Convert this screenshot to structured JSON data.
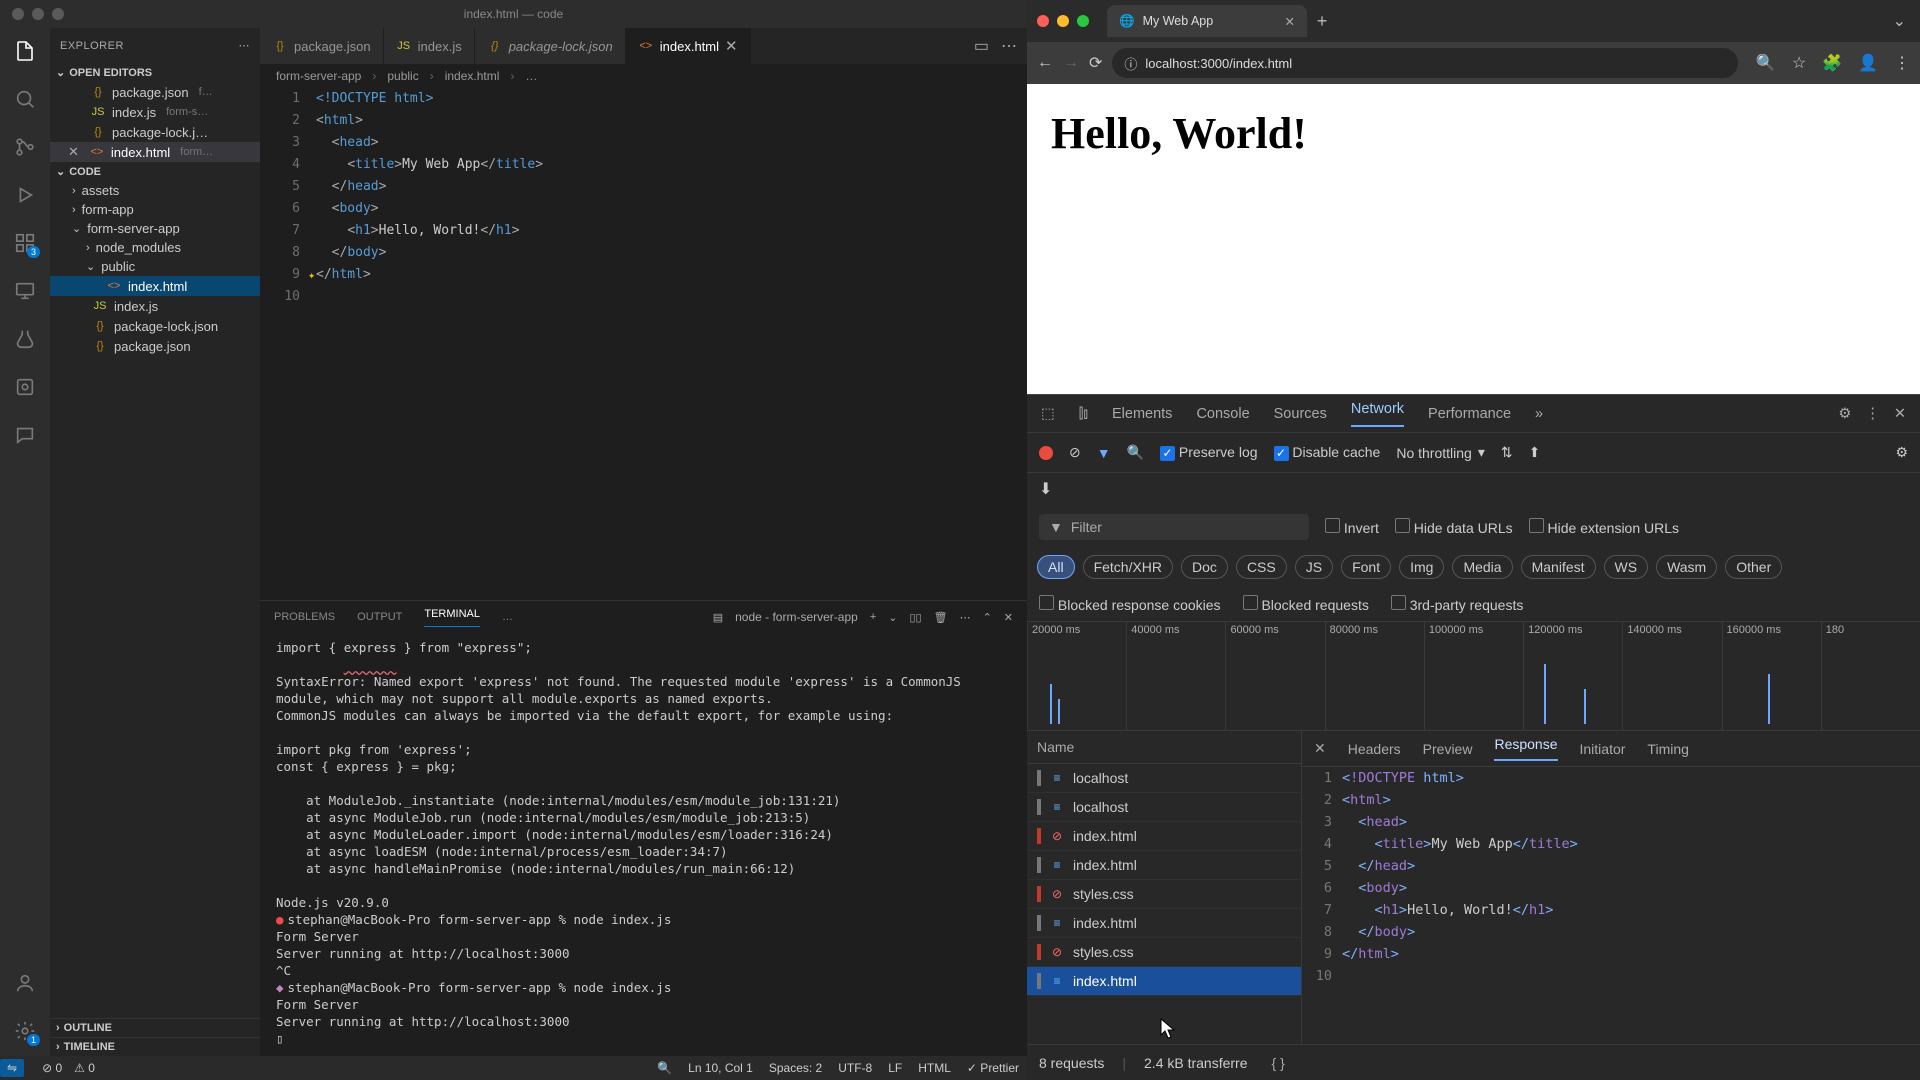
{
  "vscode": {
    "title": "index.html — code",
    "explorer_label": "EXPLORER",
    "open_editors_label": "OPEN EDITORS",
    "open_editors": [
      {
        "icon": "{}",
        "name": "package.json",
        "desc": "f…"
      },
      {
        "icon": "JS",
        "name": "index.js",
        "desc": "form-s…"
      },
      {
        "icon": "{}",
        "name": "package-lock.j…",
        "desc": ""
      },
      {
        "icon": "<>",
        "name": "index.html",
        "desc": "form…",
        "close": true,
        "active": true
      }
    ],
    "workspace_label": "CODE",
    "tree": [
      {
        "type": "folder",
        "name": "assets",
        "indent": 1
      },
      {
        "type": "folder",
        "name": "form-app",
        "indent": 1
      },
      {
        "type": "folder",
        "name": "form-server-app",
        "indent": 1,
        "open": true
      },
      {
        "type": "folder",
        "name": "node_modules",
        "indent": 2
      },
      {
        "type": "folder",
        "name": "public",
        "indent": 2,
        "open": true
      },
      {
        "type": "file",
        "name": "index.html",
        "indent": 3,
        "icon": "<>",
        "active": true
      },
      {
        "type": "file",
        "name": "index.js",
        "indent": 2,
        "icon": "JS"
      },
      {
        "type": "file",
        "name": "package-lock.json",
        "indent": 2,
        "icon": "{}"
      },
      {
        "type": "file",
        "name": "package.json",
        "indent": 2,
        "icon": "{}"
      }
    ],
    "outline_label": "OUTLINE",
    "timeline_label": "TIMELINE",
    "tabs": [
      {
        "icon": "{}",
        "label": "package.json"
      },
      {
        "icon": "JS",
        "label": "index.js"
      },
      {
        "icon": "{}",
        "label": "package-lock.json",
        "italic": true
      },
      {
        "icon": "<>",
        "label": "index.html",
        "active": true,
        "close": true
      }
    ],
    "breadcrumbs": [
      "form-server-app",
      "public",
      "index.html",
      "…"
    ],
    "code_lines": [
      "<!DOCTYPE html>",
      "<html>",
      "  <head>",
      "    <title>My Web App</title>",
      "  </head>",
      "  <body>",
      "    <h1>Hello, World!</h1>",
      "  </body>",
      "</html>",
      ""
    ],
    "panel": {
      "tabs": [
        "PROBLEMS",
        "OUTPUT",
        "TERMINAL",
        "…"
      ],
      "task": "node - form-server-app",
      "terminal_text": "import { express } from \"express\";\n         ^^^^^^^\nSyntaxError: Named export 'express' not found. The requested module 'express' is a CommonJS module, which may not support all module.exports as named exports.\nCommonJS modules can always be imported via the default export, for example using:\n\nimport pkg from 'express';\nconst { express } = pkg;\n\n    at ModuleJob._instantiate (node:internal/modules/esm/module_job:131:21)\n    at async ModuleJob.run (node:internal/modules/esm/module_job:213:5)\n    at async ModuleLoader.import (node:internal/modules/esm/loader:316:24)\n    at async loadESM (node:internal/process/esm_loader:34:7)\n    at async handleMainPromise (node:internal/modules/run_main:66:12)\n\nNode.js v20.9.0",
      "prompt1": "stephan@MacBook-Pro form-server-app % node index.js",
      "out1": "Form Server\nServer running at http://localhost:3000\n^C",
      "prompt2": "stephan@MacBook-Pro form-server-app % node index.js",
      "out2": "Form Server\nServer running at http://localhost:3000\n▯"
    },
    "status": {
      "errors": "0",
      "warnings": "0",
      "ln": "Ln 10, Col 1",
      "spaces": "Spaces: 2",
      "enc": "UTF-8",
      "eol": "LF",
      "lang": "HTML",
      "prettier": "✓ Prettier"
    }
  },
  "browser": {
    "tab_title": "My Web App",
    "url": "localhost:3000/index.html",
    "page_h1": "Hello, World!",
    "devtools": {
      "tabs": [
        "Elements",
        "Console",
        "Sources",
        "Network",
        "Performance"
      ],
      "active_tab": "Network",
      "preserve": "Preserve log",
      "disable": "Disable cache",
      "throttle": "No throttling",
      "filter_ph": "Filter",
      "invert": "Invert",
      "hide_urls": "Hide data URLs",
      "hide_ext": "Hide extension URLs",
      "pills": [
        "All",
        "Fetch/XHR",
        "Doc",
        "CSS",
        "JS",
        "Font",
        "Img",
        "Media",
        "Manifest",
        "WS",
        "Wasm",
        "Other"
      ],
      "blocked_cookies": "Blocked response cookies",
      "blocked_req": "Blocked requests",
      "third": "3rd-party requests",
      "timeline_ticks": [
        "20000 ms",
        "40000 ms",
        "60000 ms",
        "80000 ms",
        "100000 ms",
        "120000 ms",
        "140000 ms",
        "160000 ms",
        "180"
      ],
      "name_col": "Name",
      "requests": [
        {
          "name": "localhost",
          "status": "ok"
        },
        {
          "name": "localhost",
          "status": "ok"
        },
        {
          "name": "index.html",
          "status": "bad"
        },
        {
          "name": "index.html",
          "status": "ok"
        },
        {
          "name": "styles.css",
          "status": "bad"
        },
        {
          "name": "index.html",
          "status": "ok"
        },
        {
          "name": "styles.css",
          "status": "bad"
        },
        {
          "name": "index.html",
          "status": "ok",
          "selected": true
        }
      ],
      "detail_tabs": [
        "Headers",
        "Preview",
        "Response",
        "Initiator",
        "Timing"
      ],
      "active_detail": "Response",
      "response_lines": [
        "<!DOCTYPE html>",
        "<html>",
        "  <head>",
        "    <title>My Web App</title>",
        "  </head>",
        "  <body>",
        "    <h1>Hello, World!</h1>",
        "  </body>",
        "</html>",
        ""
      ],
      "status_l": "8 requests",
      "status_r": "2.4 kB transferre"
    }
  }
}
